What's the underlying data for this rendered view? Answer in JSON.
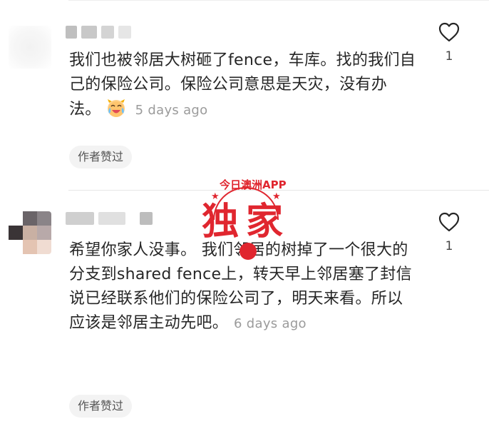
{
  "comments": [
    {
      "text": "我们也被邻居大树砸了fence，车库。找的我们自己的保险公司。保险公司意思是天灾，没有办法。",
      "emoji": "crying-laughing-face",
      "time": "5 days ago",
      "author_liked": "作者赞过",
      "likes": "1"
    },
    {
      "text": "希望你家人没事。 我们邻居的树掉了一个很大的分支到shared fence上，转天早上邻居塞了封信说已经联系他们的保险公司了，明天来看。所以应该是邻居主动先吧。",
      "time": "6 days ago",
      "author_liked": "作者赞过",
      "likes": "1"
    }
  ],
  "watermark": {
    "small": "今日澳洲APP",
    "big": "独家"
  },
  "colors": {
    "watermark_red": "#e0262f",
    "meta_gray": "#9b9b9b"
  }
}
